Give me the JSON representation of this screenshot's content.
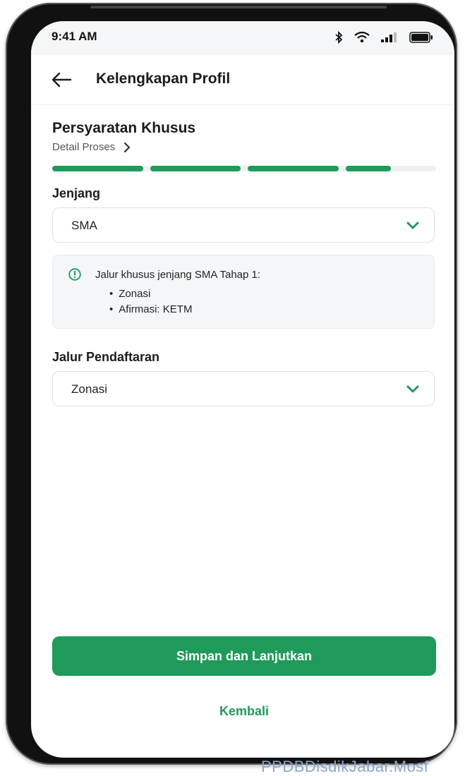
{
  "status_bar": {
    "time": "9:41 AM"
  },
  "header": {
    "title": "Kelengkapan Profil",
    "back_icon": "arrow-left-icon"
  },
  "section": {
    "title": "Persyaratan Khusus",
    "detail_link": "Detail Proses",
    "progress_segments_filled": 3.5,
    "progress_segments_total": 4
  },
  "jenjang": {
    "label": "Jenjang",
    "value": "SMA"
  },
  "info": {
    "title": "Jalur khusus jenjang SMA Tahap 1:",
    "items": [
      "Zonasi",
      "Afirmasi: KETM"
    ]
  },
  "jalur": {
    "label": "Jalur Pendaftaran",
    "value": "Zonasi"
  },
  "actions": {
    "primary_label": "Simpan dan Lanjutkan",
    "secondary_label": "Kembali"
  },
  "colors": {
    "accent": "#1e9b5a",
    "track": "#eef0f2"
  },
  "watermark": "PPDBDisdikJabar.Mosf"
}
